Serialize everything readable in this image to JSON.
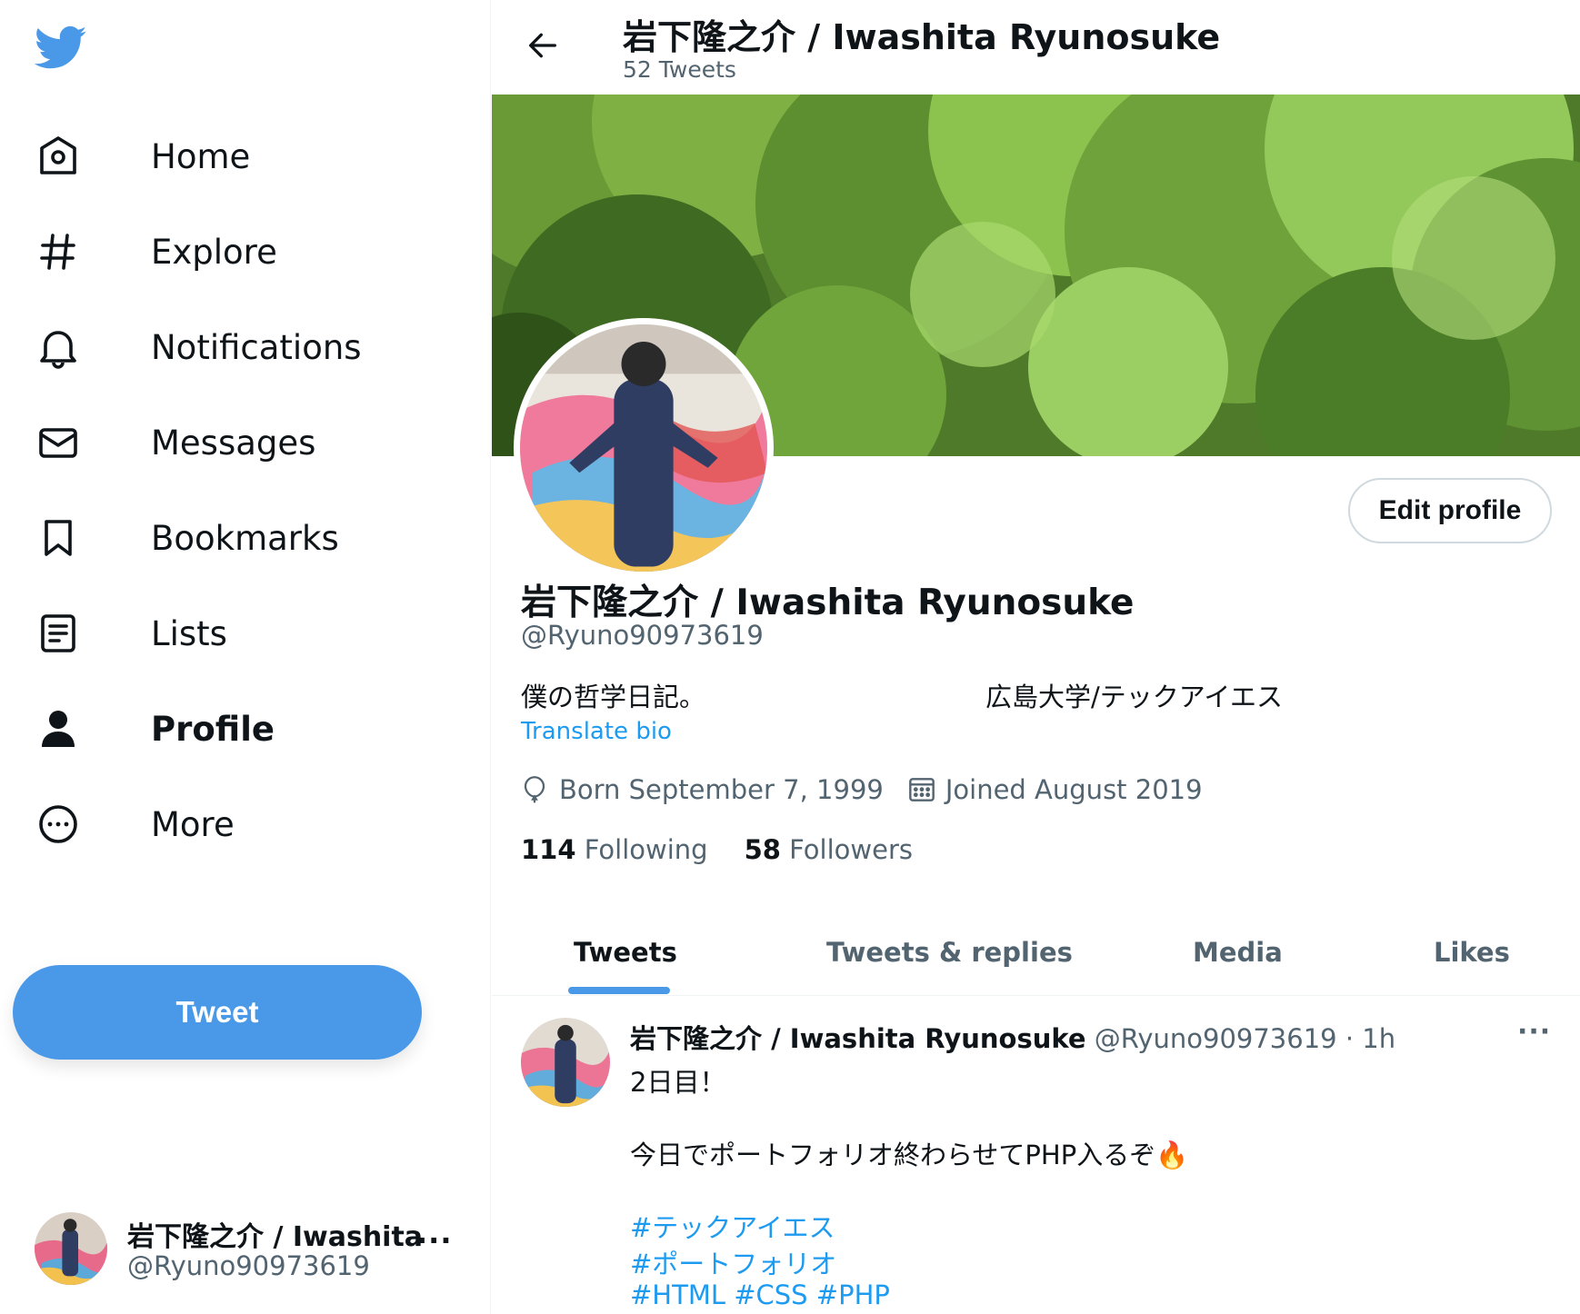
{
  "sidebar": {
    "logo_icon": "twitter-bird-icon",
    "items": [
      {
        "label": "Home",
        "icon": "home-icon"
      },
      {
        "label": "Explore",
        "icon": "hashtag-icon"
      },
      {
        "label": "Notifications",
        "icon": "bell-icon"
      },
      {
        "label": "Messages",
        "icon": "envelope-icon"
      },
      {
        "label": "Bookmarks",
        "icon": "bookmark-icon"
      },
      {
        "label": "Lists",
        "icon": "list-icon"
      },
      {
        "label": "Profile",
        "icon": "person-icon",
        "active": true
      },
      {
        "label": "More",
        "icon": "more-circle-icon"
      }
    ],
    "tweet_button": "Tweet",
    "account": {
      "name": "岩下隆之介 / Iwashita Ryunosuke",
      "handle": "@Ryuno90973619",
      "menu": "···"
    }
  },
  "header": {
    "title": "岩下隆之介 / Iwashita Ryunosuke",
    "subtitle": "52 Tweets"
  },
  "profile": {
    "name": "岩下隆之介 / Iwashita Ryunosuke",
    "handle": "@Ryuno90973619",
    "bio_left": "僕の哲学日記。",
    "bio_right": "広島大学/テックアイエス",
    "translate": "Translate bio",
    "born": "Born September 7, 1999",
    "joined": "Joined August 2019",
    "following_count": "114",
    "following_label": "Following",
    "followers_count": "58",
    "followers_label": "Followers",
    "edit_button": "Edit profile"
  },
  "tabs": [
    {
      "label": "Tweets",
      "active": true
    },
    {
      "label": "Tweets & replies"
    },
    {
      "label": "Media"
    },
    {
      "label": "Likes"
    }
  ],
  "tweet": {
    "name": "岩下隆之介 / Iwashita Ryunosuke",
    "handle_time": "@Ryuno90973619 · 1h",
    "more": "···",
    "line1": "2日目！",
    "line2": "今日でポートフォリオ終わらせてPHP入るぞ🔥",
    "hashtags": [
      "#テックアイエス",
      "#ポートフォリオ",
      "#HTML #CSS #PHP"
    ]
  },
  "colors": {
    "accent": "#4a99e9",
    "link": "#1d9bf0",
    "text": "#0f1419",
    "secondary": "#536471"
  }
}
